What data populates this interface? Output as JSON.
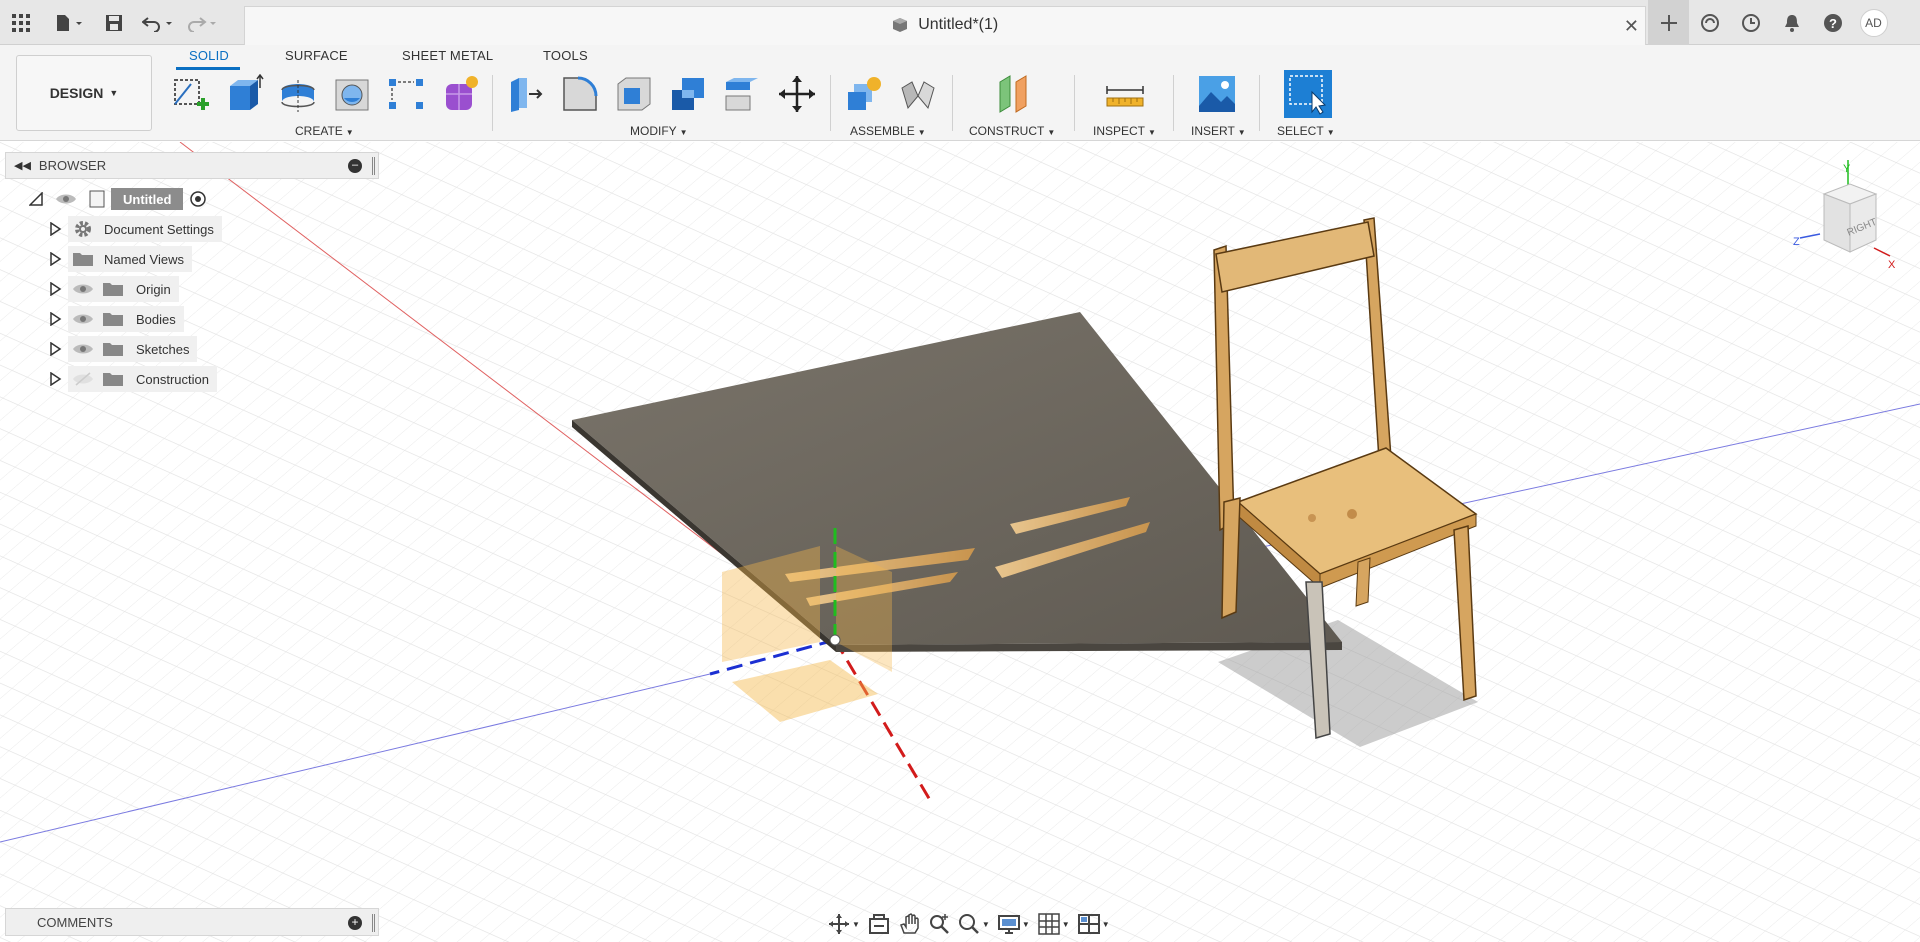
{
  "titlebar": {
    "document_title": "Untitled*(1)",
    "user_initials": "AD"
  },
  "toolbar": {
    "workspace": "DESIGN",
    "tabs": [
      {
        "label": "SOLID",
        "active": true
      },
      {
        "label": "SURFACE",
        "active": false
      },
      {
        "label": "SHEET METAL",
        "active": false
      },
      {
        "label": "TOOLS",
        "active": false
      }
    ],
    "groups": {
      "create": "CREATE",
      "modify": "MODIFY",
      "assemble": "ASSEMBLE",
      "construct": "CONSTRUCT",
      "inspect": "INSPECT",
      "insert": "INSERT",
      "select": "SELECT"
    },
    "icons": {
      "create": [
        "create-sketch-icon",
        "extrude-icon",
        "revolve-icon",
        "hole-icon",
        "pattern-icon",
        "form-icon"
      ],
      "modify": [
        "press-pull-icon",
        "fillet-icon",
        "shell-icon",
        "combine-icon",
        "offset-face-icon",
        "move-icon"
      ],
      "assemble": [
        "new-component-icon",
        "joint-icon"
      ],
      "construct": [
        "offset-plane-icon"
      ],
      "inspect": [
        "measure-icon"
      ],
      "insert": [
        "insert-image-icon"
      ],
      "select": [
        "select-window-icon"
      ]
    }
  },
  "browser": {
    "title": "BROWSER",
    "root": "Untitled",
    "items": [
      {
        "label": "Document Settings",
        "icon": "gear-icon"
      },
      {
        "label": "Named Views",
        "icon": "folder-icon"
      },
      {
        "label": "Origin",
        "icon": "folder-icon"
      },
      {
        "label": "Bodies",
        "icon": "folder-icon"
      },
      {
        "label": "Sketches",
        "icon": "folder-icon"
      },
      {
        "label": "Construction",
        "icon": "folder-icon"
      }
    ]
  },
  "comments": {
    "title": "COMMENTS"
  },
  "viewcube": {
    "face_label": "RIGHT",
    "axes": [
      "Y",
      "Z",
      "X"
    ]
  },
  "navbar": {
    "icons": [
      "orbit-icon",
      "look-at-icon",
      "pan-icon",
      "zoom-icon",
      "fit-icon",
      "display-settings-icon",
      "grid-settings-icon",
      "viewports-icon"
    ]
  },
  "colors": {
    "accent": "#0a6fc2",
    "wood": "#d9ab6a",
    "sheet": "#706a60",
    "x_axis": "#d21b1b",
    "y_axis": "#1fbd1f",
    "z_axis": "#1b2fd2"
  }
}
